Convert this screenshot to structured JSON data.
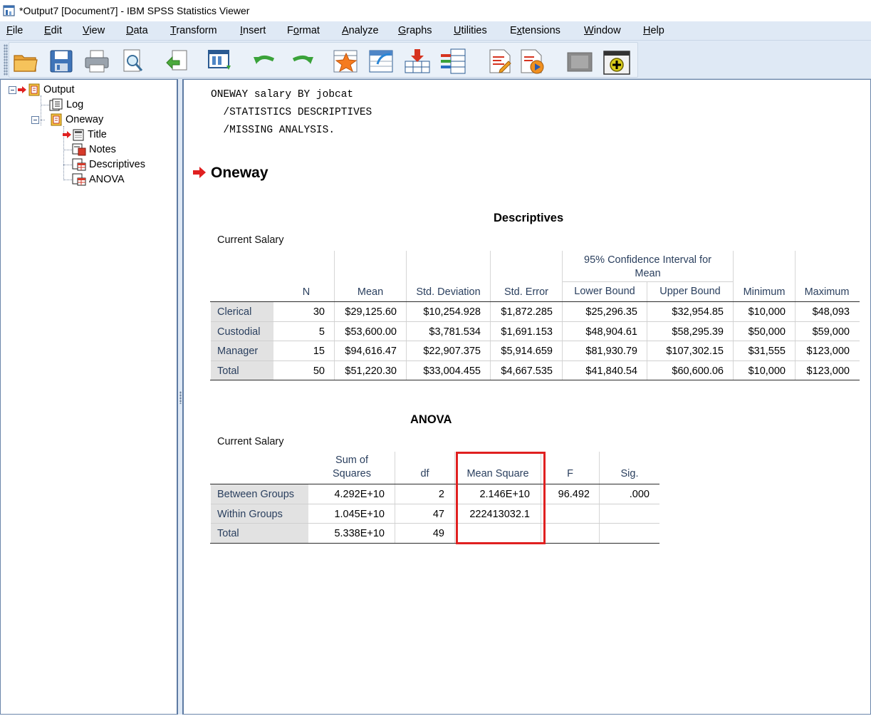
{
  "window": {
    "title": "*Output7 [Document7] - IBM SPSS Statistics Viewer"
  },
  "menu": [
    {
      "pre": "",
      "mn": "F",
      "post": "ile"
    },
    {
      "pre": "",
      "mn": "E",
      "post": "dit"
    },
    {
      "pre": "",
      "mn": "V",
      "post": "iew"
    },
    {
      "pre": "",
      "mn": "D",
      "post": "ata"
    },
    {
      "pre": "",
      "mn": "T",
      "post": "ransform"
    },
    {
      "pre": "",
      "mn": "I",
      "post": "nsert"
    },
    {
      "pre": "F",
      "mn": "o",
      "post": "rmat"
    },
    {
      "pre": "",
      "mn": "A",
      "post": "nalyze"
    },
    {
      "pre": "",
      "mn": "G",
      "post": "raphs"
    },
    {
      "pre": "",
      "mn": "U",
      "post": "tilities"
    },
    {
      "pre": "E",
      "mn": "x",
      "post": "tensions"
    },
    {
      "pre": "",
      "mn": "W",
      "post": "indow"
    },
    {
      "pre": "",
      "mn": "H",
      "post": "elp"
    }
  ],
  "toolbar": [
    "open-folder-icon",
    "save-icon",
    "print-icon",
    "print-preview-icon",
    "export-icon",
    "recall-dialog-icon",
    "undo-icon",
    "redo-icon",
    "goto-data-icon",
    "goto-case-icon",
    "insert-cases-icon",
    "variables-icon",
    "syntax-editor-icon",
    "run-script-icon",
    "disabled-icon",
    "designate-window-icon"
  ],
  "outline": {
    "root": "Output",
    "log": "Log",
    "oneway": "Oneway",
    "title": "Title",
    "notes": "Notes",
    "descriptives": "Descriptives",
    "anova": "ANOVA"
  },
  "syntax": [
    "ONEWAY salary BY jobcat",
    "  /STATISTICS DESCRIPTIVES",
    "  /MISSING ANALYSIS."
  ],
  "heading": "Oneway",
  "descriptives": {
    "title": "Descriptives",
    "subtitle": "Current Salary",
    "ci_header_line1": "95% Confidence Interval for",
    "ci_header_line2": "Mean",
    "headers": {
      "n": "N",
      "mean": "Mean",
      "sd": "Std. Deviation",
      "se": "Std. Error",
      "lower": "Lower Bound",
      "upper": "Upper Bound",
      "min": "Minimum",
      "max": "Maximum"
    },
    "rows": [
      {
        "label": "Clerical",
        "n": "30",
        "mean": "$29,125.60",
        "sd": "$10,254.928",
        "se": "$1,872.285",
        "lower": "$25,296.35",
        "upper": "$32,954.85",
        "min": "$10,000",
        "max": "$48,093"
      },
      {
        "label": "Custodial",
        "n": "5",
        "mean": "$53,600.00",
        "sd": "$3,781.534",
        "se": "$1,691.153",
        "lower": "$48,904.61",
        "upper": "$58,295.39",
        "min": "$50,000",
        "max": "$59,000"
      },
      {
        "label": "Manager",
        "n": "15",
        "mean": "$94,616.47",
        "sd": "$22,907.375",
        "se": "$5,914.659",
        "lower": "$81,930.79",
        "upper": "$107,302.15",
        "min": "$31,555",
        "max": "$123,000"
      },
      {
        "label": "Total",
        "n": "50",
        "mean": "$51,220.30",
        "sd": "$33,004.455",
        "se": "$4,667.535",
        "lower": "$41,840.54",
        "upper": "$60,600.06",
        "min": "$10,000",
        "max": "$123,000"
      }
    ]
  },
  "anova": {
    "title": "ANOVA",
    "subtitle": "Current Salary",
    "headers": {
      "ss_line1": "Sum of",
      "ss_line2": "Squares",
      "df": "df",
      "ms": "Mean Square",
      "f": "F",
      "sig": "Sig."
    },
    "rows": [
      {
        "label": "Between Groups",
        "ss": "4.292E+10",
        "df": "2",
        "ms": "2.146E+10",
        "f": "96.492",
        "sig": ".000"
      },
      {
        "label": "Within Groups",
        "ss": "1.045E+10",
        "df": "47",
        "ms": "222413032.1",
        "f": "",
        "sig": ""
      },
      {
        "label": "Total",
        "ss": "5.338E+10",
        "df": "49",
        "ms": "",
        "f": "",
        "sig": ""
      }
    ]
  }
}
